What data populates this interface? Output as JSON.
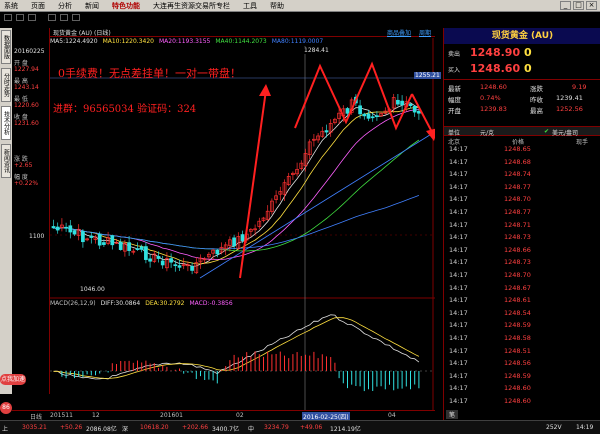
{
  "menu": [
    "系统",
    "页面",
    "分析",
    "新闻",
    "特色功能",
    "大连再生资源交易所专栏",
    "工具",
    "帮助"
  ],
  "menu_highlight_index": 4,
  "sidebar": {
    "tabs": [
      "数据面版",
      "分时走势",
      "技术分析",
      "新闻资讯"
    ]
  },
  "info": {
    "date": "20160225",
    "open_label": "开 盘",
    "open": "1227.94",
    "high_label": "最 高",
    "high": "1243.14",
    "low_label": "最 低",
    "low": "1220.60",
    "close_label": "收 盘",
    "close": "1231.60",
    "change_label": "涨 跌",
    "change": "+2.65",
    "amp_label": "幅 度",
    "amp": "+0.22%"
  },
  "chart": {
    "title": "现货黄金 (AU) (日线)",
    "tabs": [
      "商品叠加",
      "周期"
    ],
    "ma_legend": [
      {
        "text": "MA5:1224.4920",
        "color": "#e0e0e0"
      },
      {
        "text": "MA10:1220.3420",
        "color": "#ffe040"
      },
      {
        "text": "MA20:1193.3155",
        "color": "#ff60ff"
      },
      {
        "text": "MA40:1144.2073",
        "color": "#40e040"
      },
      {
        "text": "MA80:1119.0007",
        "color": "#4080ff"
      }
    ],
    "price_high_label": "1284.41",
    "price_low_label": "1046.00",
    "axis_1100": "1100",
    "axis_1000": "1000",
    "cursor_price": "1255.21",
    "macd_legend": [
      {
        "text": "MACD(26,12,9)",
        "color": "#c0c0c0"
      },
      {
        "text": "DIFF:30.0864",
        "color": "#e0e0e0"
      },
      {
        "text": "DEA:30.2792",
        "color": "#ffe040"
      },
      {
        "text": "MACD:-0.3856",
        "color": "#ff60ff"
      }
    ],
    "macd_ticks": [
      "40",
      "30",
      "20",
      "10",
      "0",
      "-10",
      "-20"
    ],
    "promo_line1": "0手续费！无点差挂单！一对一带盘！",
    "promo_line2": "进群：96565034  验证码：324",
    "floating_label": "点我加速",
    "left_icon_text": "86"
  },
  "xaxis": {
    "labels": [
      "日线",
      "201511",
      "12",
      "201601",
      "02",
      "2016-02-25(四)",
      "04"
    ]
  },
  "statusbar": [
    {
      "text": "上",
      "color": "#e0e0e0"
    },
    {
      "text": "3035.21",
      "color": "#ff4040"
    },
    {
      "text": "+50.26",
      "color": "#ff4040"
    },
    {
      "text": "2086.08亿",
      "color": "#e0e0e0"
    },
    {
      "text": "深",
      "color": "#e0e0e0"
    },
    {
      "text": "10618.20",
      "color": "#ff4040"
    },
    {
      "text": "+202.66",
      "color": "#ff4040"
    },
    {
      "text": "3400.7亿",
      "color": "#e0e0e0"
    },
    {
      "text": "中",
      "color": "#e0e0e0"
    },
    {
      "text": "3234.79",
      "color": "#ff4040"
    },
    {
      "text": "+49.06",
      "color": "#ff4040"
    },
    {
      "text": "1214.19亿",
      "color": "#e0e0e0"
    },
    {
      "text": "252V",
      "color": "#e0e0e0"
    },
    {
      "text": "14:19",
      "color": "#e0e0e0"
    }
  ],
  "quote": {
    "title": "现货黄金 (AU)",
    "sell_label": "卖出",
    "sell": "1248.90",
    "sell_vol": "0",
    "buy_label": "买入",
    "buy": "1248.60",
    "buy_vol": "0",
    "latest_label": "最新",
    "latest": "1248.60",
    "change_label": "涨跌",
    "change": "9.19",
    "pct_label": "幅度",
    "pct": "0.74%",
    "prevclose_label": "昨收",
    "prevclose": "1239.41",
    "open_label": "开盘",
    "open": "1239.83",
    "high_label": "最高",
    "high": "1252.56",
    "unit_label": "单位",
    "unit": "元/克",
    "fx": "美元/盎司",
    "head_tz": "北京",
    "head_price": "价格",
    "head_vol": "现手",
    "ticks": [
      {
        "t": "14:17",
        "p": "1248.65"
      },
      {
        "t": "14:17",
        "p": "1248.68"
      },
      {
        "t": "14:17",
        "p": "1248.74"
      },
      {
        "t": "14:17",
        "p": "1248.77"
      },
      {
        "t": "14:17",
        "p": "1248.70"
      },
      {
        "t": "14:17",
        "p": "1248.77"
      },
      {
        "t": "14:17",
        "p": "1248.71"
      },
      {
        "t": "14:17",
        "p": "1248.73"
      },
      {
        "t": "14:17",
        "p": "1248.66"
      },
      {
        "t": "14:17",
        "p": "1248.73"
      },
      {
        "t": "14:17",
        "p": "1248.70"
      },
      {
        "t": "14:17",
        "p": "1248.67"
      },
      {
        "t": "14:17",
        "p": "1248.61"
      },
      {
        "t": "14:17",
        "p": "1248.54"
      },
      {
        "t": "14:17",
        "p": "1248.59"
      },
      {
        "t": "14:17",
        "p": "1248.58"
      },
      {
        "t": "14:17",
        "p": "1248.51"
      },
      {
        "t": "14:17",
        "p": "1248.56"
      },
      {
        "t": "14:17",
        "p": "1248.59"
      },
      {
        "t": "14:17",
        "p": "1248.60"
      },
      {
        "t": "14:17",
        "p": "1248.60"
      }
    ],
    "bottom_tab": "笔"
  }
}
